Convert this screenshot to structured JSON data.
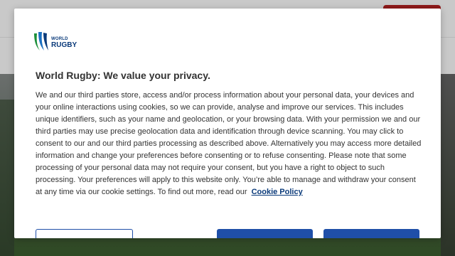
{
  "brand": {
    "logo_line1": "WORLD",
    "logo_line2": "RUGBY",
    "logo_colors": [
      "#1b8f3a",
      "#1a6fc1",
      "#0a3a7a"
    ]
  },
  "consent": {
    "title": "World Rugby: We value your privacy.",
    "body": "We and our third parties store, access and/or process information about your personal data, your devices and your online interactions using cookies, so we can provide, analyse and improve our services. This includes unique identifiers, such as your name and geolocation, or your browsing data. With your permission we and our third parties may use precise geolocation data and identification through device scanning. You may click to consent to our and our third parties processing as described above. Alternatively you may access more detailed information and change your preferences before consenting or to refuse consenting. Please note that some processing of your personal data may not require your consent, but you have a right to object to such processing. Your preferences will apply to this website only. You’re able to manage and withdraw your consent at any time via our cookie settings. To find out more, read our",
    "cookie_policy_link": "Cookie Policy"
  },
  "buttons": {
    "outline_label": "",
    "primary1_label": "",
    "primary2_label": ""
  },
  "colors": {
    "primary": "#1f4fa8",
    "header_cta": "#8e1a1a"
  }
}
